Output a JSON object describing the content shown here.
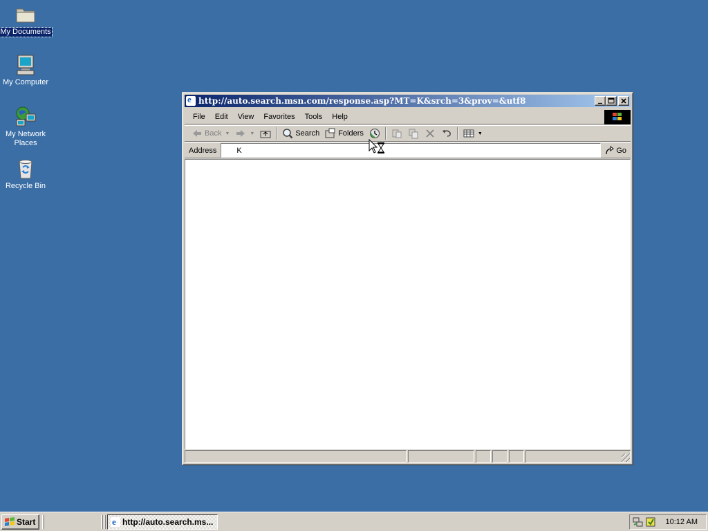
{
  "desktop": {
    "icons": [
      {
        "label": "My Documents",
        "icon": "folder-icon"
      },
      {
        "label": "My Computer",
        "icon": "computer-icon"
      },
      {
        "label": "My Network Places",
        "icon": "network-icon"
      },
      {
        "label": "Recycle Bin",
        "icon": "recycle-bin-icon"
      }
    ]
  },
  "window": {
    "title": "http://auto.search.msn.com/response.asp?MT=K&srch=3&prov=&utf8",
    "menu": [
      "File",
      "Edit",
      "View",
      "Favorites",
      "Tools",
      "Help"
    ],
    "toolbar": {
      "back": "Back",
      "search": "Search",
      "folders": "Folders"
    },
    "address": {
      "label": "Address",
      "value": "K",
      "go": "Go"
    }
  },
  "taskbar": {
    "start": "Start",
    "task": "http://auto.search.ms...",
    "clock": "10:12 AM"
  },
  "colors": {
    "desktop": "#3a6ea5",
    "titlebar_start": "#0a246a",
    "titlebar_end": "#a6caf0",
    "face": "#d4d0c8"
  }
}
